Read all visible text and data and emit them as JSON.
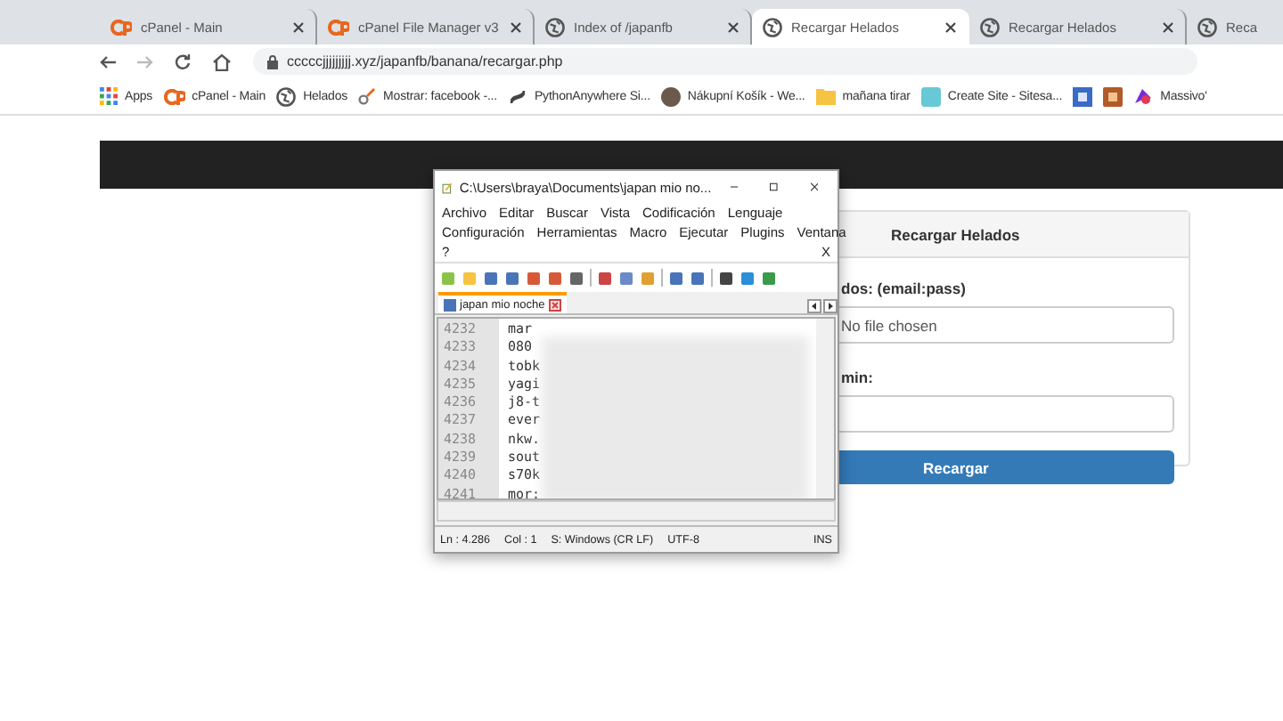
{
  "browser": {
    "tabs": [
      {
        "title": "cPanel - Main",
        "selected": false
      },
      {
        "title": "cPanel File Manager v3",
        "selected": false
      },
      {
        "title": "Index of /japanfb",
        "selected": false
      },
      {
        "title": "Recargar Helados",
        "selected": true
      },
      {
        "title": "Recargar Helados",
        "selected": false
      },
      {
        "title": "Reca",
        "selected": false
      }
    ],
    "url": "ccccсjjjjjjjjj.xyz/japanfb/banana/recargar.php",
    "bookmarks": [
      "Apps",
      "cPanel - Main",
      "Helados",
      "Mostrar: facebook -...",
      "PythonAnywhere Si...",
      "Nákupní Košík - We...",
      "mañana tirar",
      "Create Site - Sitesa...",
      "Massivo'"
    ]
  },
  "page": {
    "panel_title": "Recargar Helados",
    "file_label": "dos: (email:pass)",
    "file_status": "No file chosen",
    "second_label": "min:",
    "button": "Recargar"
  },
  "editor": {
    "title": "C:\\Users\\braya\\Documents\\japan mio no...",
    "menu_rows": [
      [
        "Archivo",
        "Editar",
        "Buscar",
        "Vista",
        "Codificación",
        "Lenguaje"
      ],
      [
        "Configuración",
        "Herramientas",
        "Macro",
        "Ejecutar",
        "Plugins",
        "Ventana"
      ],
      [
        "?"
      ]
    ],
    "close_doc": "X",
    "tab": "japan mio noche",
    "lines": [
      {
        "number": "4232",
        "text": "mar"
      },
      {
        "number": "4233",
        "text": "080"
      },
      {
        "number": "4234",
        "text": "tobk"
      },
      {
        "number": "4235",
        "text": "yagi"
      },
      {
        "number": "4236",
        "text": "j8-t"
      },
      {
        "number": "4237",
        "text": "ever"
      },
      {
        "number": "4238",
        "text": "nkw."
      },
      {
        "number": "4239",
        "text": "sout"
      },
      {
        "number": "4240",
        "text": "s70k"
      },
      {
        "number": "4241",
        "text": "mor:"
      }
    ],
    "status": [
      "Ln : 4.286",
      "Col : 1",
      "S: Windows (CR LF)",
      "UTF-8",
      "INS"
    ]
  }
}
